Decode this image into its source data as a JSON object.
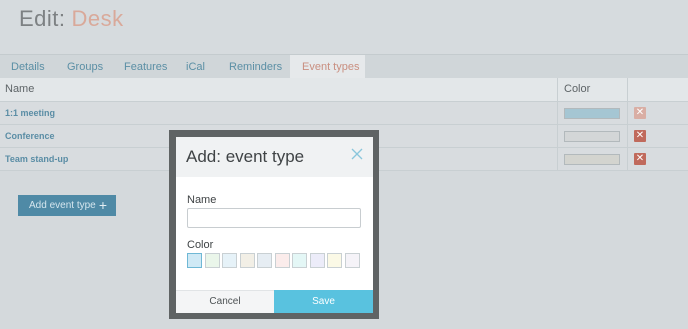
{
  "page": {
    "title_prefix": "Edit:",
    "title_entity": "Desk"
  },
  "tabs": [
    {
      "label": "Details",
      "active": false
    },
    {
      "label": "Groups",
      "active": false
    },
    {
      "label": "Features",
      "active": false
    },
    {
      "label": "iCal",
      "active": false
    },
    {
      "label": "Reminders",
      "active": false
    },
    {
      "label": "Event types",
      "active": true
    }
  ],
  "table": {
    "headers": {
      "name": "Name",
      "color": "Color"
    },
    "rows": [
      {
        "name": "1:1 meeting",
        "color": "#a5c6d3",
        "delete_color": "#d9aea4"
      },
      {
        "name": "Conference",
        "color": "#d3d6d7",
        "delete_color": "#c06a5c"
      },
      {
        "name": "Team stand-up",
        "color": "#d3d4cf",
        "delete_color": "#c06a5c"
      }
    ],
    "delete_icon": "close-icon"
  },
  "add_button": {
    "label": "Add event type",
    "icon": "plus-icon"
  },
  "modal": {
    "title": "Add: event type",
    "close_icon": "close-icon",
    "name_label": "Name",
    "name_value": "",
    "color_label": "Color",
    "colors": [
      "#cfe9f5",
      "#eaf6ea",
      "#e6f2f8",
      "#f2efe6",
      "#e6edf3",
      "#fbeceb",
      "#e4f7f6",
      "#ececf9",
      "#fbf9e6",
      "#f5f3f8"
    ],
    "selected_color_index": 0,
    "cancel_label": "Cancel",
    "save_label": "Save"
  }
}
